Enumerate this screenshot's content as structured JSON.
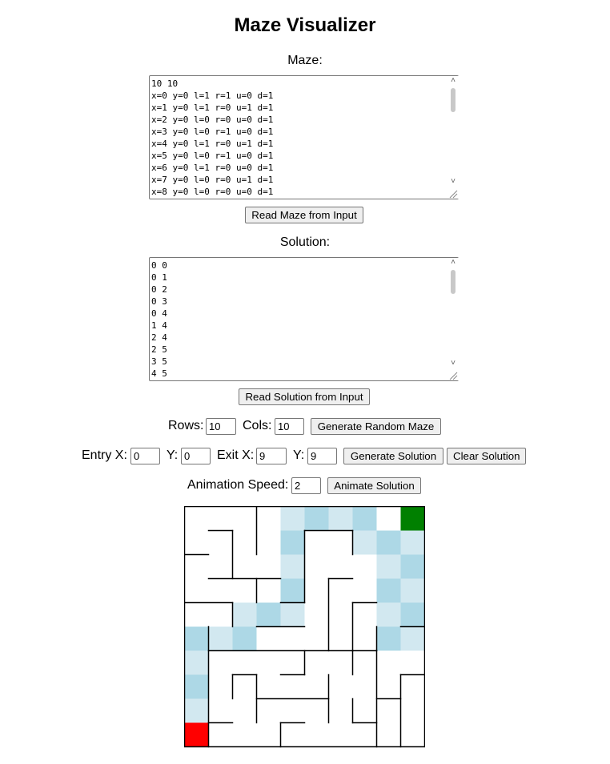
{
  "title": "Maze Visualizer",
  "maze_section": {
    "label": "Maze:",
    "text": "10 10\nx=0 y=0 l=1 r=1 u=0 d=1\nx=1 y=0 l=1 r=0 u=1 d=1\nx=2 y=0 l=0 r=0 u=0 d=1\nx=3 y=0 l=0 r=1 u=0 d=1\nx=4 y=0 l=1 r=0 u=1 d=1\nx=5 y=0 l=0 r=1 u=0 d=1\nx=6 y=0 l=1 r=0 u=0 d=1\nx=7 y=0 l=0 r=0 u=1 d=1\nx=8 y=0 l=0 r=0 u=0 d=1",
    "button": "Read Maze from Input"
  },
  "solution_section": {
    "label": "Solution:",
    "text": "0 0\n0 1\n0 2\n0 3\n0 4\n1 4\n2 4\n2 5\n3 5\n4 5",
    "button": "Read Solution from Input"
  },
  "controls": {
    "rows_label": "Rows:",
    "rows_value": "10",
    "cols_label": "Cols:",
    "cols_value": "10",
    "generate_maze": "Generate Random Maze",
    "entry_x_label": "Entry X:",
    "entry_x_value": "0",
    "entry_y_label": "Y:",
    "entry_y_value": "0",
    "exit_x_label": "Exit X:",
    "exit_x_value": "9",
    "exit_y_label": "Y:",
    "exit_y_value": "9",
    "generate_solution": "Generate Solution",
    "clear_solution": "Clear Solution",
    "speed_label": "Animation Speed:",
    "speed_value": "2",
    "animate": "Animate Solution"
  },
  "maze_grid": {
    "rows": 10,
    "cols": 10,
    "colors": {
      "entry": "#ff0000",
      "exit": "#008000",
      "path_light": "#d2e8f0",
      "path_mid": "#add8e6",
      "wall": "#000000",
      "background": "#ffffff"
    },
    "entry_cell": [
      0,
      9
    ],
    "exit_cell": [
      9,
      0
    ],
    "path_cells": [
      [
        4,
        0,
        "light"
      ],
      [
        5,
        0,
        "mid"
      ],
      [
        6,
        0,
        "light"
      ],
      [
        7,
        0,
        "mid"
      ],
      [
        4,
        1,
        "mid"
      ],
      [
        7,
        1,
        "light"
      ],
      [
        8,
        1,
        "mid"
      ],
      [
        9,
        1,
        "light"
      ],
      [
        4,
        2,
        "light"
      ],
      [
        8,
        2,
        "light"
      ],
      [
        9,
        2,
        "mid"
      ],
      [
        4,
        3,
        "mid"
      ],
      [
        8,
        3,
        "mid"
      ],
      [
        9,
        3,
        "light"
      ],
      [
        2,
        4,
        "light"
      ],
      [
        3,
        4,
        "mid"
      ],
      [
        4,
        4,
        "light"
      ],
      [
        8,
        4,
        "light"
      ],
      [
        9,
        4,
        "mid"
      ],
      [
        0,
        5,
        "mid"
      ],
      [
        1,
        5,
        "light"
      ],
      [
        2,
        5,
        "mid"
      ],
      [
        8,
        5,
        "mid"
      ],
      [
        9,
        5,
        "light"
      ],
      [
        0,
        6,
        "light"
      ],
      [
        0,
        7,
        "mid"
      ],
      [
        0,
        8,
        "light"
      ]
    ],
    "wall_segments": [
      [
        1,
        1,
        2,
        1
      ],
      [
        2,
        1,
        2,
        3
      ],
      [
        3,
        0,
        3,
        2
      ],
      [
        5,
        1,
        7,
        1
      ],
      [
        5,
        1,
        5,
        4
      ],
      [
        7,
        1,
        7,
        2
      ],
      [
        0,
        2,
        1,
        2
      ],
      [
        1,
        3,
        4,
        3
      ],
      [
        6,
        3,
        7,
        3
      ],
      [
        6,
        3,
        6,
        6
      ],
      [
        3,
        3,
        3,
        4
      ],
      [
        0,
        4,
        2,
        4
      ],
      [
        2,
        4,
        2,
        5
      ],
      [
        4,
        4,
        5,
        4
      ],
      [
        7,
        4,
        7,
        6
      ],
      [
        7,
        4,
        8,
        4
      ],
      [
        3,
        5,
        5,
        5
      ],
      [
        7,
        6,
        8,
        6
      ],
      [
        8,
        5,
        8,
        6
      ],
      [
        9,
        5,
        10,
        5
      ],
      [
        1,
        5,
        1,
        10
      ],
      [
        1,
        6,
        7,
        6
      ],
      [
        5,
        6,
        5,
        7
      ],
      [
        7,
        6,
        7,
        7
      ],
      [
        4,
        7,
        5,
        7
      ],
      [
        2,
        7,
        2,
        8
      ],
      [
        2,
        7,
        3,
        7
      ],
      [
        3,
        7,
        3,
        9
      ],
      [
        3,
        8,
        6,
        8
      ],
      [
        6,
        7,
        6,
        9
      ],
      [
        8,
        6,
        8,
        10
      ],
      [
        9,
        7,
        9,
        10
      ],
      [
        9,
        7,
        10,
        7
      ],
      [
        7,
        8,
        7,
        9
      ],
      [
        7,
        9,
        8,
        9
      ],
      [
        8,
        8,
        9,
        8
      ],
      [
        4,
        9,
        4,
        10
      ],
      [
        4,
        9,
        5,
        9
      ],
      [
        1,
        9,
        2,
        9
      ]
    ]
  }
}
